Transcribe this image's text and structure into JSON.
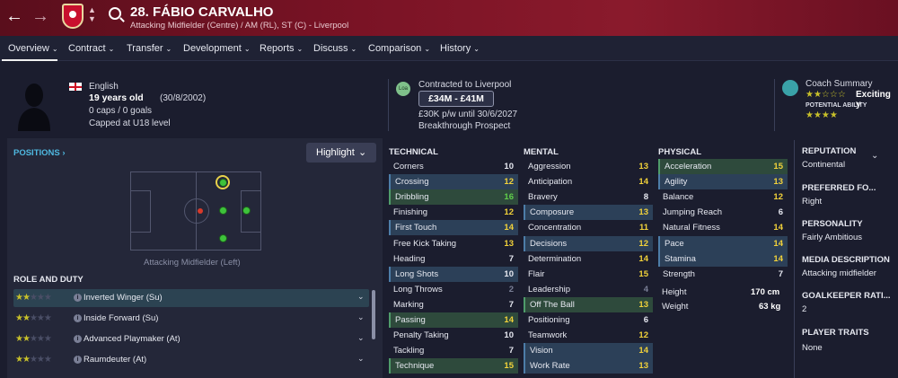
{
  "header": {
    "title": "28. FÁBIO CARVALHO",
    "subtitle": "Attacking Midfielder (Centre) / AM (RL), ST (C) - Liverpool",
    "back_icon": "←",
    "forward_icon": "→",
    "up_down_icon": "⌃⌄"
  },
  "nav": {
    "items": [
      {
        "label": "Overview"
      },
      {
        "label": "Contract"
      },
      {
        "label": "Transfer"
      },
      {
        "label": "Development"
      },
      {
        "label": "Reports"
      },
      {
        "label": "Discuss"
      },
      {
        "label": "Comparison"
      },
      {
        "label": "History"
      }
    ],
    "chevron": "⌄"
  },
  "bio": {
    "nationality": "English",
    "age": "19 years old",
    "dob": "(30/8/2002)",
    "caps": "0 caps / 0 goals",
    "capped_level": "Capped at U18 level"
  },
  "contract": {
    "club_badge": "Loa",
    "contracted": "Contracted to Liverpool",
    "value": "£34M - £41M",
    "wage": "£30K p/w until 30/6/2027",
    "status": "Breakthrough Prospect"
  },
  "coach": {
    "title": "Coach Summary",
    "summary": "Exciting y",
    "potential_label": "POTENTIAL ABILITY",
    "current_stars": "★★☆☆☆",
    "potential_stars": "★★★★"
  },
  "positions": {
    "title": "POSITIONS",
    "title_chevron": "›",
    "highlight_label": "Highlight",
    "highlight_chevron": "⌄",
    "pitch_caption": "Attacking Midfielder (Left)",
    "role_title": "ROLE AND DUTY",
    "roles": [
      {
        "stars_on": "★★",
        "stars_off": "★★★",
        "label": "Inverted Winger (Su)"
      },
      {
        "stars_on": "★★",
        "stars_off": "★★★",
        "label": "Inside Forward (Su)"
      },
      {
        "stars_on": "★★",
        "stars_off": "★★★",
        "label": "Advanced Playmaker (At)"
      },
      {
        "stars_on": "★★",
        "stars_off": "★★★",
        "label": "Raumdeuter (At)"
      }
    ],
    "info_glyph": "i",
    "chevron": "⌄"
  },
  "technical": {
    "title": "TECHNICAL",
    "rows": [
      {
        "name": "Corners",
        "value": "10"
      },
      {
        "name": "Crossing",
        "value": "12"
      },
      {
        "name": "Dribbling",
        "value": "16"
      },
      {
        "name": "Finishing",
        "value": "12"
      },
      {
        "name": "First Touch",
        "value": "14"
      },
      {
        "name": "Free Kick Taking",
        "value": "13"
      },
      {
        "name": "Heading",
        "value": "7"
      },
      {
        "name": "Long Shots",
        "value": "10"
      },
      {
        "name": "Long Throws",
        "value": "2"
      },
      {
        "name": "Marking",
        "value": "7"
      },
      {
        "name": "Passing",
        "value": "14"
      },
      {
        "name": "Penalty Taking",
        "value": "10"
      },
      {
        "name": "Tackling",
        "value": "7"
      },
      {
        "name": "Technique",
        "value": "15"
      }
    ]
  },
  "mental": {
    "title": "MENTAL",
    "rows": [
      {
        "name": "Aggression",
        "value": "13"
      },
      {
        "name": "Anticipation",
        "value": "14"
      },
      {
        "name": "Bravery",
        "value": "8"
      },
      {
        "name": "Composure",
        "value": "13"
      },
      {
        "name": "Concentration",
        "value": "11"
      },
      {
        "name": "Decisions",
        "value": "12"
      },
      {
        "name": "Determination",
        "value": "14"
      },
      {
        "name": "Flair",
        "value": "15"
      },
      {
        "name": "Leadership",
        "value": "4"
      },
      {
        "name": "Off The Ball",
        "value": "13"
      },
      {
        "name": "Positioning",
        "value": "6"
      },
      {
        "name": "Teamwork",
        "value": "12"
      },
      {
        "name": "Vision",
        "value": "14"
      },
      {
        "name": "Work Rate",
        "value": "13"
      }
    ]
  },
  "physical": {
    "title": "PHYSICAL",
    "rows": [
      {
        "name": "Acceleration",
        "value": "15"
      },
      {
        "name": "Agility",
        "value": "13"
      },
      {
        "name": "Balance",
        "value": "12"
      },
      {
        "name": "Jumping Reach",
        "value": "6"
      },
      {
        "name": "Natural Fitness",
        "value": "14"
      },
      {
        "name": "Pace",
        "value": "14"
      },
      {
        "name": "Stamina",
        "value": "14"
      },
      {
        "name": "Strength",
        "value": "7"
      }
    ],
    "height_label": "Height",
    "height": "170 cm",
    "weight_label": "Weight",
    "weight": "63 kg"
  },
  "info_panel": {
    "reputation_label": "REPUTATION",
    "reputation": "Continental",
    "chevron": "⌄",
    "preferred_foot_label": "PREFERRED FO...",
    "preferred_foot": "Right",
    "personality_label": "PERSONALITY",
    "personality": "Fairly Ambitious",
    "media_label": "MEDIA DESCRIPTION",
    "media": "Attacking midfielder",
    "gk_label": "GOALKEEPER RATI...",
    "gk": "2",
    "traits_label": "PLAYER TRAITS",
    "traits": "None"
  }
}
